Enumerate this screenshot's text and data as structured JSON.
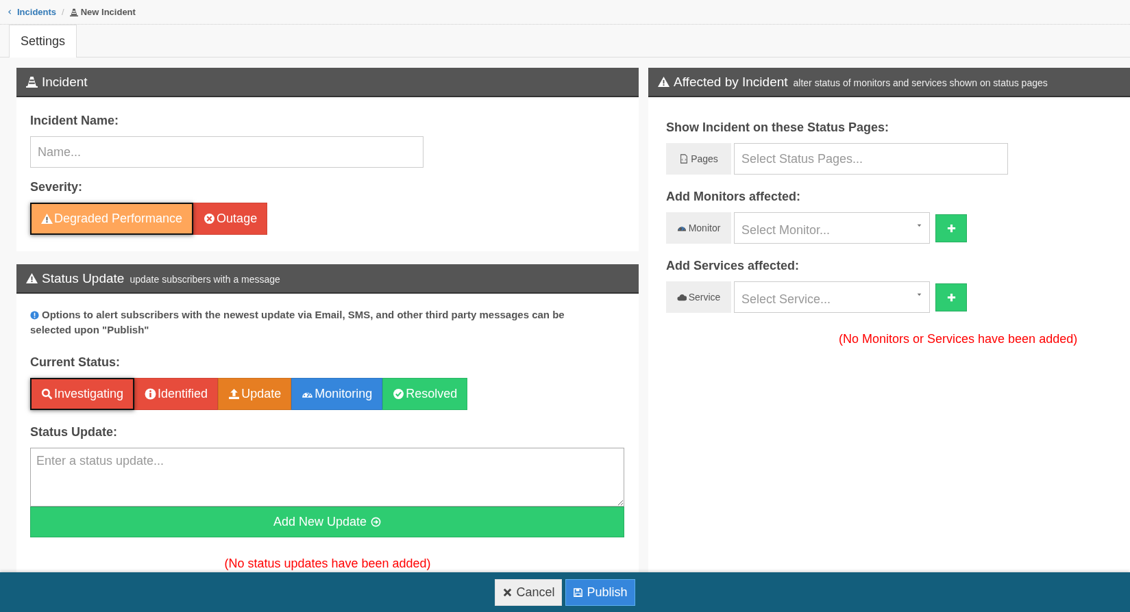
{
  "breadcrumb_separator": "/",
  "breadcrumb": [
    {
      "label": "Incidents",
      "kind": "link"
    },
    {
      "label": "New Incident",
      "kind": "current"
    }
  ],
  "tabs": [
    {
      "label": "Settings",
      "selected": true
    }
  ],
  "incident_panel": {
    "title": "Incident",
    "name_label": "Incident Name:",
    "name_field": {
      "placeholder": "Name..."
    },
    "severity_label": "Severity:",
    "severity_options": [
      {
        "kind": "degraded",
        "label": "Degraded Performance",
        "selected": true
      },
      {
        "kind": "outage",
        "label": "Outage",
        "selected": false
      }
    ]
  },
  "status_update_panel": {
    "title": "Status Update",
    "subtitle": "update subscribers with a message",
    "info": "Options to alert subscribers with the newest update via Email, SMS, and other third party messages can be selected upon \"Publish\"",
    "current_status_label": "Current Status:",
    "statuses": [
      {
        "kind": "investigating",
        "label": "Investigating",
        "selected": true
      },
      {
        "kind": "identified",
        "label": "Identified",
        "selected": false
      },
      {
        "kind": "update",
        "label": "Update",
        "selected": false
      },
      {
        "kind": "monitoring",
        "label": "Monitoring",
        "selected": false
      },
      {
        "kind": "resolved",
        "label": "Resolved",
        "selected": false
      }
    ],
    "update_label": "Status Update:",
    "update_field": {
      "placeholder": "Enter a status update..."
    },
    "add_button": "Add New Update",
    "empty_message": "(No status updates have been added)"
  },
  "affected_panel": {
    "title": "Affected by Incident",
    "subtitle": "alter status of monitors and services shown on status pages",
    "groups": [
      {
        "kind": "pages",
        "label": "Show Incident on these Status Pages:",
        "addon": "Pages",
        "placeholder": "Select Status Pages...",
        "dropdown": false,
        "add_button": false
      },
      {
        "kind": "monitor",
        "label": "Add Monitors affected:",
        "addon": "Monitor",
        "placeholder": "Select Monitor...",
        "dropdown": true,
        "add_button": true
      },
      {
        "kind": "service",
        "label": "Add Services affected:",
        "addon": "Service",
        "placeholder": "Select Service...",
        "dropdown": true,
        "add_button": true
      }
    ],
    "empty_message": "(No Monitors or Services have been added)"
  },
  "footer": {
    "buttons": [
      {
        "kind": "cancel",
        "label": "Cancel"
      },
      {
        "kind": "publish",
        "label": "Publish"
      }
    ]
  }
}
